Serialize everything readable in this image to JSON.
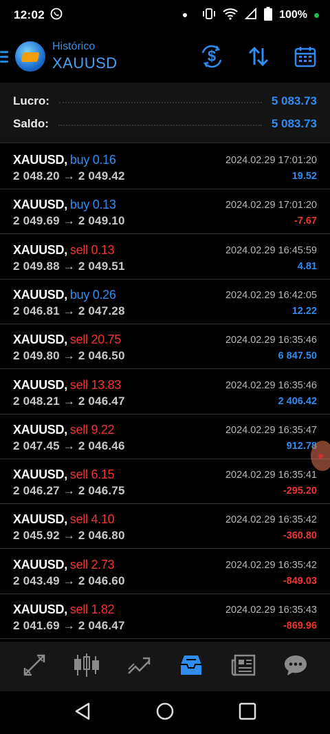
{
  "status_bar": {
    "time": "12:02",
    "battery": "100%"
  },
  "header": {
    "subtitle": "Histórico",
    "title": "XAUUSD"
  },
  "summary": {
    "profit_label": "Lucro:",
    "profit_value": "5 083.73",
    "balance_label": "Saldo:",
    "balance_value": "5 083.73"
  },
  "trades": [
    {
      "symbol": "XAUUSD,",
      "side": "buy",
      "volume": "0.16",
      "prices": "2 048.20 → 2 049.42",
      "date": "2024.02.29 17:01:20",
      "pl": "19.52"
    },
    {
      "symbol": "XAUUSD,",
      "side": "buy",
      "volume": "0.13",
      "prices": "2 049.69 → 2 049.10",
      "date": "2024.02.29 17:01:20",
      "pl": "-7.67"
    },
    {
      "symbol": "XAUUSD,",
      "side": "sell",
      "volume": "0.13",
      "prices": "2 049.88 → 2 049.51",
      "date": "2024.02.29 16:45:59",
      "pl": "4.81"
    },
    {
      "symbol": "XAUUSD,",
      "side": "buy",
      "volume": "0.26",
      "prices": "2 046.81 → 2 047.28",
      "date": "2024.02.29 16:42:05",
      "pl": "12.22"
    },
    {
      "symbol": "XAUUSD,",
      "side": "sell",
      "volume": "20.75",
      "prices": "2 049.80 → 2 046.50",
      "date": "2024.02.29 16:35:46",
      "pl": "6 847.50"
    },
    {
      "symbol": "XAUUSD,",
      "side": "sell",
      "volume": "13.83",
      "prices": "2 048.21 → 2 046.47",
      "date": "2024.02.29 16:35:46",
      "pl": "2 406.42"
    },
    {
      "symbol": "XAUUSD,",
      "side": "sell",
      "volume": "9.22",
      "prices": "2 047.45 → 2 046.46",
      "date": "2024.02.29 16:35:47",
      "pl": "912.78"
    },
    {
      "symbol": "XAUUSD,",
      "side": "sell",
      "volume": "6.15",
      "prices": "2 046.27 → 2 046.75",
      "date": "2024.02.29 16:35:41",
      "pl": "-295.20"
    },
    {
      "symbol": "XAUUSD,",
      "side": "sell",
      "volume": "4.10",
      "prices": "2 045.92 → 2 046.80",
      "date": "2024.02.29 16:35:42",
      "pl": "-360.80"
    },
    {
      "symbol": "XAUUSD,",
      "side": "sell",
      "volume": "2.73",
      "prices": "2 043.49 → 2 046.60",
      "date": "2024.02.29 16:35:42",
      "pl": "-849.03"
    },
    {
      "symbol": "XAUUSD,",
      "side": "sell",
      "volume": "1.82",
      "prices": "2 041.69 → 2 046.47",
      "date": "2024.02.29 16:35:43",
      "pl": "-869.96"
    }
  ],
  "tabbar": {
    "active_tab": "history"
  },
  "colors": {
    "accent": "#2f8cf0",
    "loss": "#ef3434",
    "background": "#000000"
  }
}
